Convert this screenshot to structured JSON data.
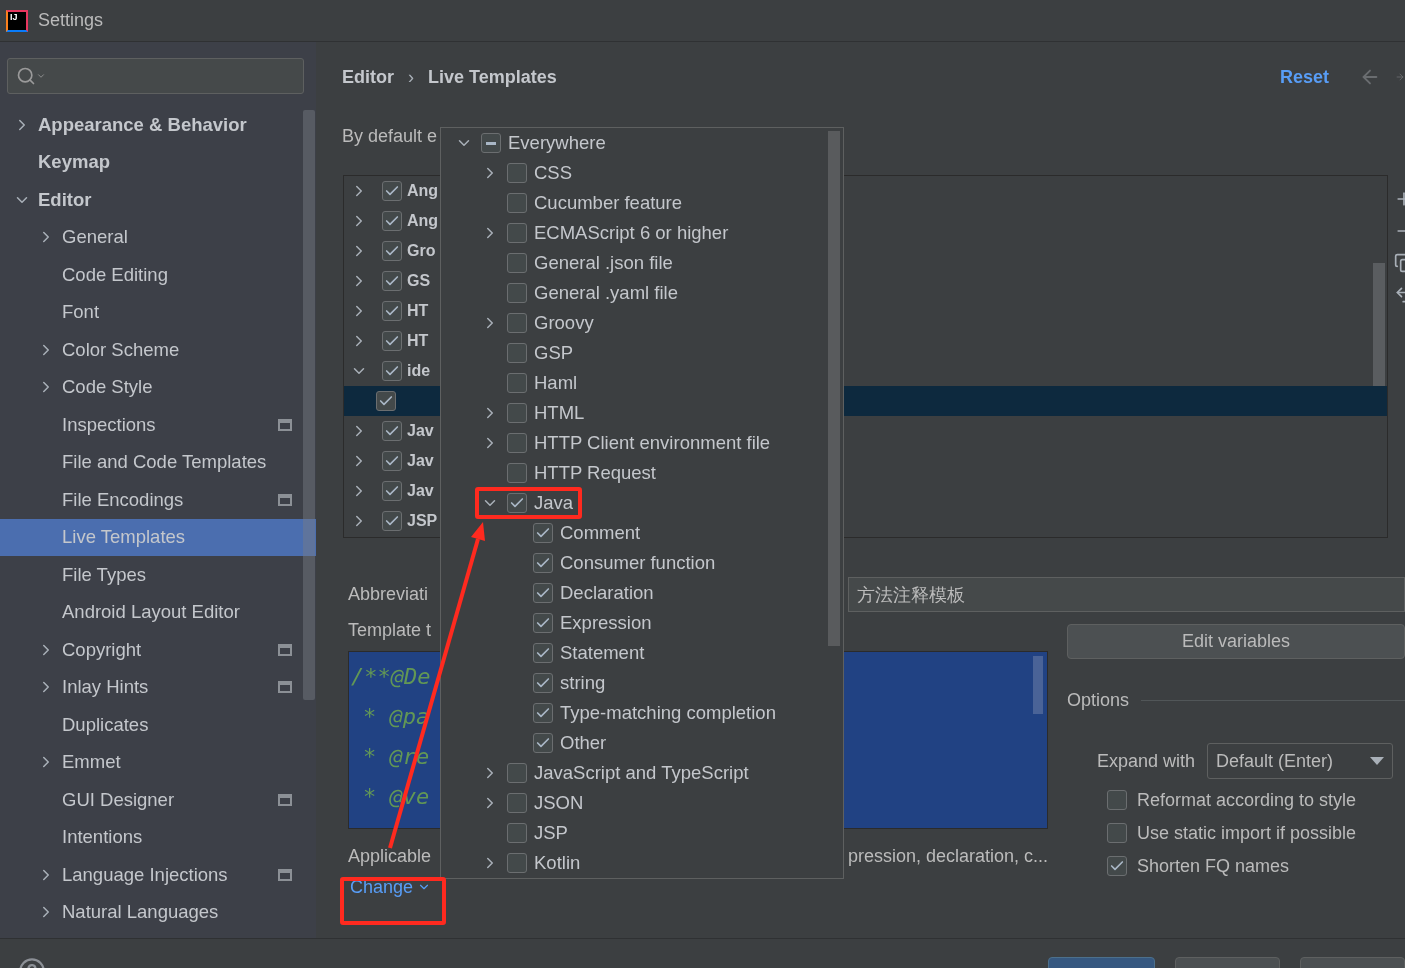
{
  "window": {
    "title": "Settings",
    "logo_text": "IJ"
  },
  "sidebar": {
    "items": [
      {
        "label": "Appearance & Behavior",
        "kind": "group",
        "expanded": false,
        "selected": false,
        "project_scope": false
      },
      {
        "label": "Keymap",
        "kind": "leaf",
        "selected": false,
        "project_scope": false
      },
      {
        "label": "Editor",
        "kind": "group",
        "expanded": true,
        "selected": false,
        "project_scope": false,
        "children": [
          {
            "label": "General",
            "kind": "group",
            "expanded": false,
            "selected": false,
            "project_scope": false
          },
          {
            "label": "Code Editing",
            "kind": "leaf",
            "selected": false,
            "project_scope": false
          },
          {
            "label": "Font",
            "kind": "leaf",
            "selected": false,
            "project_scope": false
          },
          {
            "label": "Color Scheme",
            "kind": "group",
            "expanded": false,
            "selected": false,
            "project_scope": false
          },
          {
            "label": "Code Style",
            "kind": "group",
            "expanded": false,
            "selected": false,
            "project_scope": false
          },
          {
            "label": "Inspections",
            "kind": "leaf",
            "selected": false,
            "project_scope": true
          },
          {
            "label": "File and Code Templates",
            "kind": "leaf",
            "selected": false,
            "project_scope": false
          },
          {
            "label": "File Encodings",
            "kind": "leaf",
            "selected": false,
            "project_scope": true
          },
          {
            "label": "Live Templates",
            "kind": "leaf",
            "selected": true,
            "project_scope": false
          },
          {
            "label": "File Types",
            "kind": "leaf",
            "selected": false,
            "project_scope": false
          },
          {
            "label": "Android Layout Editor",
            "kind": "leaf",
            "selected": false,
            "project_scope": false
          },
          {
            "label": "Copyright",
            "kind": "group",
            "expanded": false,
            "selected": false,
            "project_scope": true
          },
          {
            "label": "Inlay Hints",
            "kind": "group",
            "expanded": false,
            "selected": false,
            "project_scope": true
          },
          {
            "label": "Duplicates",
            "kind": "leaf",
            "selected": false,
            "project_scope": false
          },
          {
            "label": "Emmet",
            "kind": "group",
            "expanded": false,
            "selected": false,
            "project_scope": false
          },
          {
            "label": "GUI Designer",
            "kind": "leaf",
            "selected": false,
            "project_scope": true
          },
          {
            "label": "Intentions",
            "kind": "leaf",
            "selected": false,
            "project_scope": false
          },
          {
            "label": "Language Injections",
            "kind": "group",
            "expanded": false,
            "selected": false,
            "project_scope": true
          },
          {
            "label": "Natural Languages",
            "kind": "group",
            "expanded": false,
            "selected": false,
            "project_scope": false
          }
        ]
      }
    ]
  },
  "header": {
    "breadcrumb": [
      "Editor",
      "Live Templates"
    ],
    "separator": "›",
    "reset": "Reset"
  },
  "default_expand_label": "By default e",
  "template_groups": [
    {
      "label": "Ang",
      "checked": true,
      "expanded": false
    },
    {
      "label": "Ang",
      "checked": true,
      "expanded": false
    },
    {
      "label": "Gro",
      "checked": true,
      "expanded": false
    },
    {
      "label": "GS",
      "checked": true,
      "expanded": false
    },
    {
      "label": "HT",
      "checked": true,
      "expanded": false
    },
    {
      "label": "HT",
      "checked": true,
      "expanded": false
    },
    {
      "label": "ide",
      "checked": true,
      "expanded": true,
      "children": [
        {
          "checked": true,
          "selected": true
        }
      ]
    },
    {
      "label": "Jav",
      "checked": true,
      "expanded": false
    },
    {
      "label": "Jav",
      "checked": true,
      "expanded": false
    },
    {
      "label": "Jav",
      "checked": true,
      "expanded": false
    },
    {
      "label": "JSP",
      "checked": true,
      "expanded": false
    }
  ],
  "abbreviation_label": "Abbreviati",
  "description_value": "方法注释模板",
  "template_text_label": "Template t",
  "template_text": [
    "/**@De",
    "* @pa",
    "* @re",
    "* @ve"
  ],
  "applicable_label": "Applicable",
  "applicable_contexts": "pression, declaration, c...",
  "change_link": "Change",
  "edit_variables": "Edit variables",
  "options": {
    "title": "Options",
    "expand_with_label": "Expand with",
    "expand_with_value": "Default (Enter)",
    "checkboxes": [
      {
        "label": "Reformat according to style",
        "checked": false
      },
      {
        "label": "Use static import if possible",
        "checked": false
      },
      {
        "label": "Shorten FQ names",
        "checked": true
      }
    ]
  },
  "context_popup": {
    "items": [
      {
        "label": "Everywhere",
        "kind": "group",
        "expanded": true,
        "indeterminate": true,
        "children": [
          {
            "label": "CSS",
            "kind": "group",
            "expanded": false,
            "checked": false
          },
          {
            "label": "Cucumber feature",
            "kind": "leaf",
            "checked": false
          },
          {
            "label": "ECMAScript 6 or higher",
            "kind": "group",
            "expanded": false,
            "checked": false
          },
          {
            "label": "General .json file",
            "kind": "leaf",
            "checked": false
          },
          {
            "label": "General .yaml file",
            "kind": "leaf",
            "checked": false
          },
          {
            "label": "Groovy",
            "kind": "group",
            "expanded": false,
            "checked": false
          },
          {
            "label": "GSP",
            "kind": "leaf",
            "checked": false
          },
          {
            "label": "Haml",
            "kind": "leaf",
            "checked": false
          },
          {
            "label": "HTML",
            "kind": "group",
            "expanded": false,
            "checked": false
          },
          {
            "label": "HTTP Client environment file",
            "kind": "group",
            "expanded": false,
            "checked": false
          },
          {
            "label": "HTTP Request",
            "kind": "leaf",
            "checked": false
          },
          {
            "label": "Java",
            "kind": "group",
            "expanded": true,
            "checked": true,
            "children": [
              {
                "label": "Comment",
                "kind": "leaf",
                "checked": true
              },
              {
                "label": "Consumer function",
                "kind": "leaf",
                "checked": true
              },
              {
                "label": "Declaration",
                "kind": "leaf",
                "checked": true
              },
              {
                "label": "Expression",
                "kind": "leaf",
                "checked": true
              },
              {
                "label": "Statement",
                "kind": "leaf",
                "checked": true
              },
              {
                "label": "string",
                "kind": "leaf",
                "checked": true
              },
              {
                "label": "Type-matching completion",
                "kind": "leaf",
                "checked": true
              },
              {
                "label": "Other",
                "kind": "leaf",
                "checked": true
              }
            ]
          },
          {
            "label": "JavaScript and TypeScript",
            "kind": "group",
            "expanded": false,
            "checked": false
          },
          {
            "label": "JSON",
            "kind": "group",
            "expanded": false,
            "checked": false
          },
          {
            "label": "JSP",
            "kind": "leaf",
            "checked": false
          },
          {
            "label": "Kotlin",
            "kind": "group",
            "expanded": false,
            "checked": false
          }
        ]
      }
    ]
  }
}
